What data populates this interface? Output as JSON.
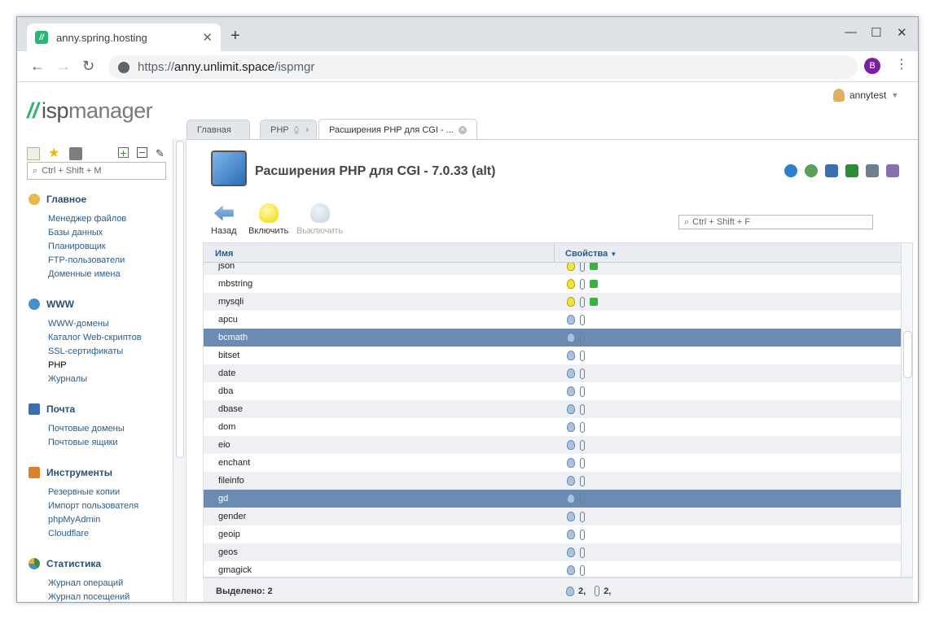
{
  "browser": {
    "tab_title": "anny.spring.hosting",
    "url_prefix": "https://",
    "url_host": "anny.unlimit.space",
    "url_path": "/ispmgr",
    "profile_initial": "B"
  },
  "app": {
    "logo_isp": "isp",
    "logo_manager": "manager",
    "user": "annytest",
    "tabs": [
      {
        "label": "Главная"
      },
      {
        "label": "PHP"
      },
      {
        "label": "Расширения PHP для CGI - ..."
      }
    ]
  },
  "sidebar": {
    "search_placeholder": "Ctrl + Shift + M",
    "groups": [
      {
        "title": "Главное",
        "items": [
          "Менеджер файлов",
          "Базы данных",
          "Планировщик",
          "FTP-пользователи",
          "Доменные имена"
        ]
      },
      {
        "title": "WWW",
        "items": [
          "WWW-домены",
          "Каталог Web-скриптов",
          "SSL-сертификаты",
          "PHP",
          "Журналы"
        ]
      },
      {
        "title": "Почта",
        "items": [
          "Почтовые домены",
          "Почтовые ящики"
        ]
      },
      {
        "title": "Инструменты",
        "items": [
          "Резервные копии",
          "Импорт пользователя",
          "phpMyAdmin",
          "Cloudflare"
        ]
      },
      {
        "title": "Статистика",
        "items": [
          "Журнал операций",
          "Журнал посещений"
        ]
      }
    ]
  },
  "main": {
    "title": "Расширения PHP для CGI - 7.0.33 (alt)",
    "toolbar": {
      "back": "Назад",
      "enable": "Включить",
      "disable": "Выключить"
    },
    "filter_placeholder": "Ctrl + Shift + F",
    "columns": {
      "name": "Имя",
      "props": "Свойства"
    },
    "rows": [
      {
        "name": "json",
        "enabled": true,
        "selected": false
      },
      {
        "name": "mbstring",
        "enabled": true,
        "selected": false
      },
      {
        "name": "mysqli",
        "enabled": true,
        "selected": false
      },
      {
        "name": "apcu",
        "enabled": false,
        "selected": false
      },
      {
        "name": "bcmath",
        "enabled": false,
        "selected": true
      },
      {
        "name": "bitset",
        "enabled": false,
        "selected": false
      },
      {
        "name": "date",
        "enabled": false,
        "selected": false
      },
      {
        "name": "dba",
        "enabled": false,
        "selected": false
      },
      {
        "name": "dbase",
        "enabled": false,
        "selected": false
      },
      {
        "name": "dom",
        "enabled": false,
        "selected": false
      },
      {
        "name": "eio",
        "enabled": false,
        "selected": false
      },
      {
        "name": "enchant",
        "enabled": false,
        "selected": false
      },
      {
        "name": "fileinfo",
        "enabled": false,
        "selected": false
      },
      {
        "name": "gd",
        "enabled": false,
        "selected": true
      },
      {
        "name": "gender",
        "enabled": false,
        "selected": false
      },
      {
        "name": "geoip",
        "enabled": false,
        "selected": false
      },
      {
        "name": "geos",
        "enabled": false,
        "selected": false
      },
      {
        "name": "gmagick",
        "enabled": false,
        "selected": false
      }
    ],
    "status": {
      "selected": "Выделено: 2",
      "count_a": "2,",
      "count_b": "2,"
    }
  }
}
